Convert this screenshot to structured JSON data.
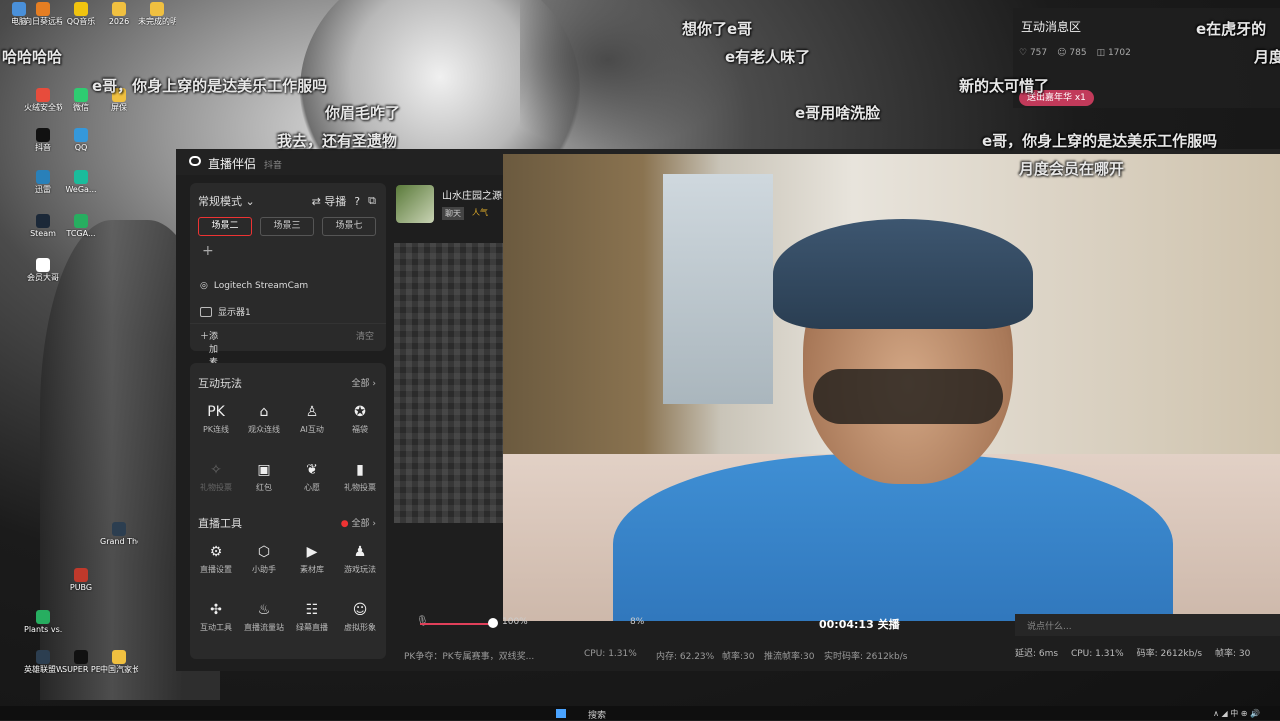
{
  "desktop": {
    "icons": [
      {
        "label": "电脑",
        "color": "#4a90d9"
      },
      {
        "label": "向日葵远程控制",
        "color": "#e67e22"
      },
      {
        "label": "QQ音乐",
        "color": "#f1c40f"
      },
      {
        "label": "2026",
        "color": "#f0c040"
      },
      {
        "label": "未完成的明星大赛",
        "color": "#f0c040"
      },
      {
        "label": "直播伴侣",
        "color": "#333333"
      },
      {
        "label": "网易云音乐",
        "color": "#d0021b"
      },
      {
        "label": "火绒安全软件",
        "color": "#e74c3c"
      },
      {
        "label": "微信",
        "color": "#2ecc71"
      },
      {
        "label": "屏保",
        "color": "#f0c040"
      },
      {
        "label": "抖音",
        "color": "#111111"
      },
      {
        "label": "QQ",
        "color": "#3498db"
      },
      {
        "label": "迅雷",
        "color": "#2980b9"
      },
      {
        "label": "WeGa...",
        "color": "#1abc9c"
      },
      {
        "label": "Steam",
        "color": "#1b2838"
      },
      {
        "label": "TCGA...",
        "color": "#27ae60"
      },
      {
        "label": "会员大哥",
        "color": "#ffffff"
      },
      {
        "label": "PUBG",
        "color": "#c0392b"
      },
      {
        "label": "Plants vs. Zo...",
        "color": "#27ae60"
      },
      {
        "label": "SUPER PEOP...",
        "color": "#111111"
      },
      {
        "label": "中国汽家长",
        "color": "#f0c040"
      },
      {
        "label": "英雄联盟WeGa...",
        "color": "#2c3e50"
      },
      {
        "label": "游戏",
        "color": "#8e44ad"
      },
      {
        "label": "Grand Theft...",
        "color": "#2c3e50"
      }
    ]
  },
  "danmaku": [
    "想你了e哥",
    "e在虎牙的",
    "e有老人味了",
    "月度",
    "e哥，你身上穿的是达美乐工作服吗",
    "你眉毛咋了",
    "新的太可惜了",
    "e哥用啥洗脸",
    "我去，还有圣遗物",
    "e哥，你身上穿的是达美乐工作服吗",
    "月度会员在哪开",
    "哈哈哈哈"
  ],
  "interact_panel": {
    "title": "互动消息区",
    "likes": "757",
    "comments": "785",
    "gifts": "1702",
    "gift_badge": "送出嘉年华 x1"
  },
  "app": {
    "title": "直播伴侣",
    "platform": "抖音",
    "mode": "常规模式",
    "switch_label": "导播",
    "scenes": [
      "场景二",
      "场景三",
      "场景七"
    ],
    "sources": [
      "Logitech StreamCam",
      "显示器1"
    ],
    "add_source": "添加素材",
    "clear_label": "清空",
    "interact_section": "互动玩法",
    "see_all": "全部",
    "interact_tools": [
      "PK连线",
      "观众连线",
      "AI互动",
      "福袋",
      "礼物投票",
      "红包",
      "心愿",
      "礼物投票"
    ],
    "live_section": "直播工具",
    "live_tools": [
      "直播设置",
      "小助手",
      "素材库",
      "游戏玩法",
      "互动工具",
      "直播流量站",
      "绿幕直播",
      "虚拟形象"
    ],
    "stream_name": "山水庄园之源",
    "tag_day": "聊天",
    "tag_hot": "人气",
    "volume": "100%",
    "mic_level": "8%",
    "timer": "00:04:13",
    "end_label": "关播",
    "status_tip": "PK争夺：PK专属赛事，双线奖...",
    "cpu": "CPU: 1.31%",
    "mem": "内存: 62.23%",
    "fps": "帧率:30",
    "push_fps": "推流帧率:30",
    "bitrate": "实时码率: 2612kb/s"
  },
  "right_bottom": {
    "chat_placeholder": "说点什么...",
    "delay": "延迟: 6ms",
    "cpu": "CPU: 1.31%",
    "rate": "码率: 2612kb/s",
    "fps": "帧率: 30",
    "push": "推流帧率"
  },
  "taskbar": {
    "search": "搜索"
  }
}
